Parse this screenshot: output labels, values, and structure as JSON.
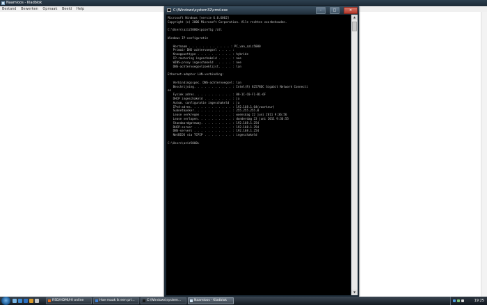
{
  "notepad": {
    "title": "Naamloos - Kladblok",
    "menu": [
      "Bestand",
      "Bewerken",
      "Opmaak",
      "Beeld",
      "Help"
    ]
  },
  "cmd": {
    "title": "C:\\Windows\\system32\\cmd.exe",
    "buttons": {
      "minimize": "–",
      "maximize": "□",
      "close": "✕"
    },
    "lines": [
      "Microsoft Windows [versie 6.0.6002]",
      "Copyright (c) 2006 Microsoft Corporation. Alle rechten voorbehouden.",
      "",
      "C:\\Users\\aziz5000>ipconfig /all",
      "",
      "Windows IP-configuratie",
      "",
      "   Hostnaam . . . . . . . . . . . . : PC_van_aziz5000",
      "   Primair DNS-achtervoegsel . . . . :",
      "   Knooppunttype . . . . . . . . . . : hybride",
      "   IP-routering ingeschakeld . . . . : nee",
      "   WINS-proxy ingeschakeld . . . . . : nee",
      "   DNS-achtervoegselzoeklijst. . . . : lan",
      "",
      "Ethernet-adapter LAN-verbinding:",
      "",
      "   Verbindingsspec. DNS-achtervoegsel: lan",
      "   Beschrijving. . . . . . . . . . . : Intel(R) 82578DC Gigabit Network Connecti",
      "on",
      "   Fysiek adres. . . . . . . . . . . : 00-1C-C0-F1-B1-6F",
      "   DHCP ingeschakeld . . . . . . . . : ja",
      "   Autom. configuratie ingeschakeld  : ja",
      "   IPv4-adres. . . . . . . . . . . . : 192.168.1.64(voorkeur)",
      "   Subnetmasker. . . . . . . . . . . : 255.255.255.0",
      "   Lease verkregen . . . . . . . . . : woensdag 22 juni 2011 9:36:56",
      "   Lease verlopen. . . . . . . . . . : donderdag 23 juni 2011 9:36:55",
      "   Standaardgateway. . . . . . . . . : 192.168.1.254",
      "   DHCP-server . . . . . . . . . . . : 192.168.1.254",
      "   DNS-servers . . . . . . . . . . . : 192.168.1.254",
      "   NetBIOS via TCPIP . . . . . . . . : ingeschakeld",
      "",
      "C:\\Users\\aziz5000>"
    ]
  },
  "taskbar": {
    "tasks": [
      {
        "label": "RSD/HDMI/HI online",
        "icon_color": "#e06a1b",
        "active": false
      },
      {
        "label": "Hoe maak ik een pri...",
        "icon_color": "#3d7fd6",
        "active": false
      },
      {
        "label": "C:\\Windows\\system...",
        "icon_color": "#1a1a1a",
        "active": false
      },
      {
        "label": "Naamloos - Kladblok",
        "icon_color": "#cfe3f3",
        "active": true
      }
    ],
    "clock": "19:25"
  }
}
